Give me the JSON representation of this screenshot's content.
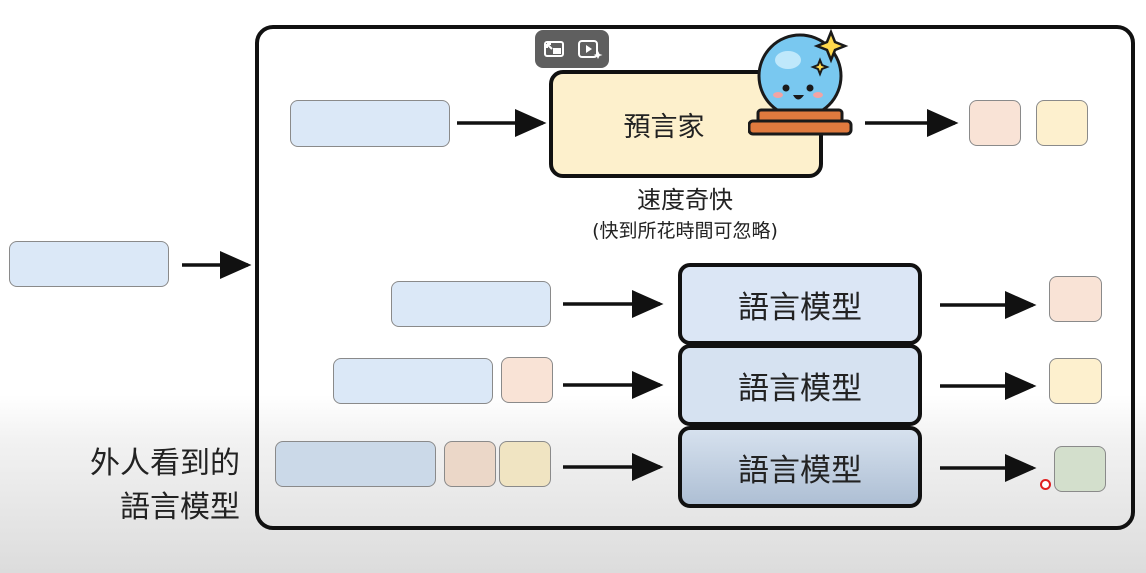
{
  "toolbar": {
    "icons": [
      "exit-pip-icon",
      "play-sparkle-icon"
    ]
  },
  "oracle": {
    "label": "預言家"
  },
  "speed": {
    "title": "速度奇快",
    "subtitle": "(快到所花時間可忽略)"
  },
  "language_model": {
    "label": "語言模型"
  },
  "outsider": {
    "line1": "外人看到的",
    "line2": "語言模型"
  },
  "colors": {
    "input": "#dbe8f7",
    "token_peach": "#f9e3d6",
    "token_cream": "#fdf0ce",
    "token_green": "#d3dfcc",
    "cursor_dot": "#e02020"
  }
}
